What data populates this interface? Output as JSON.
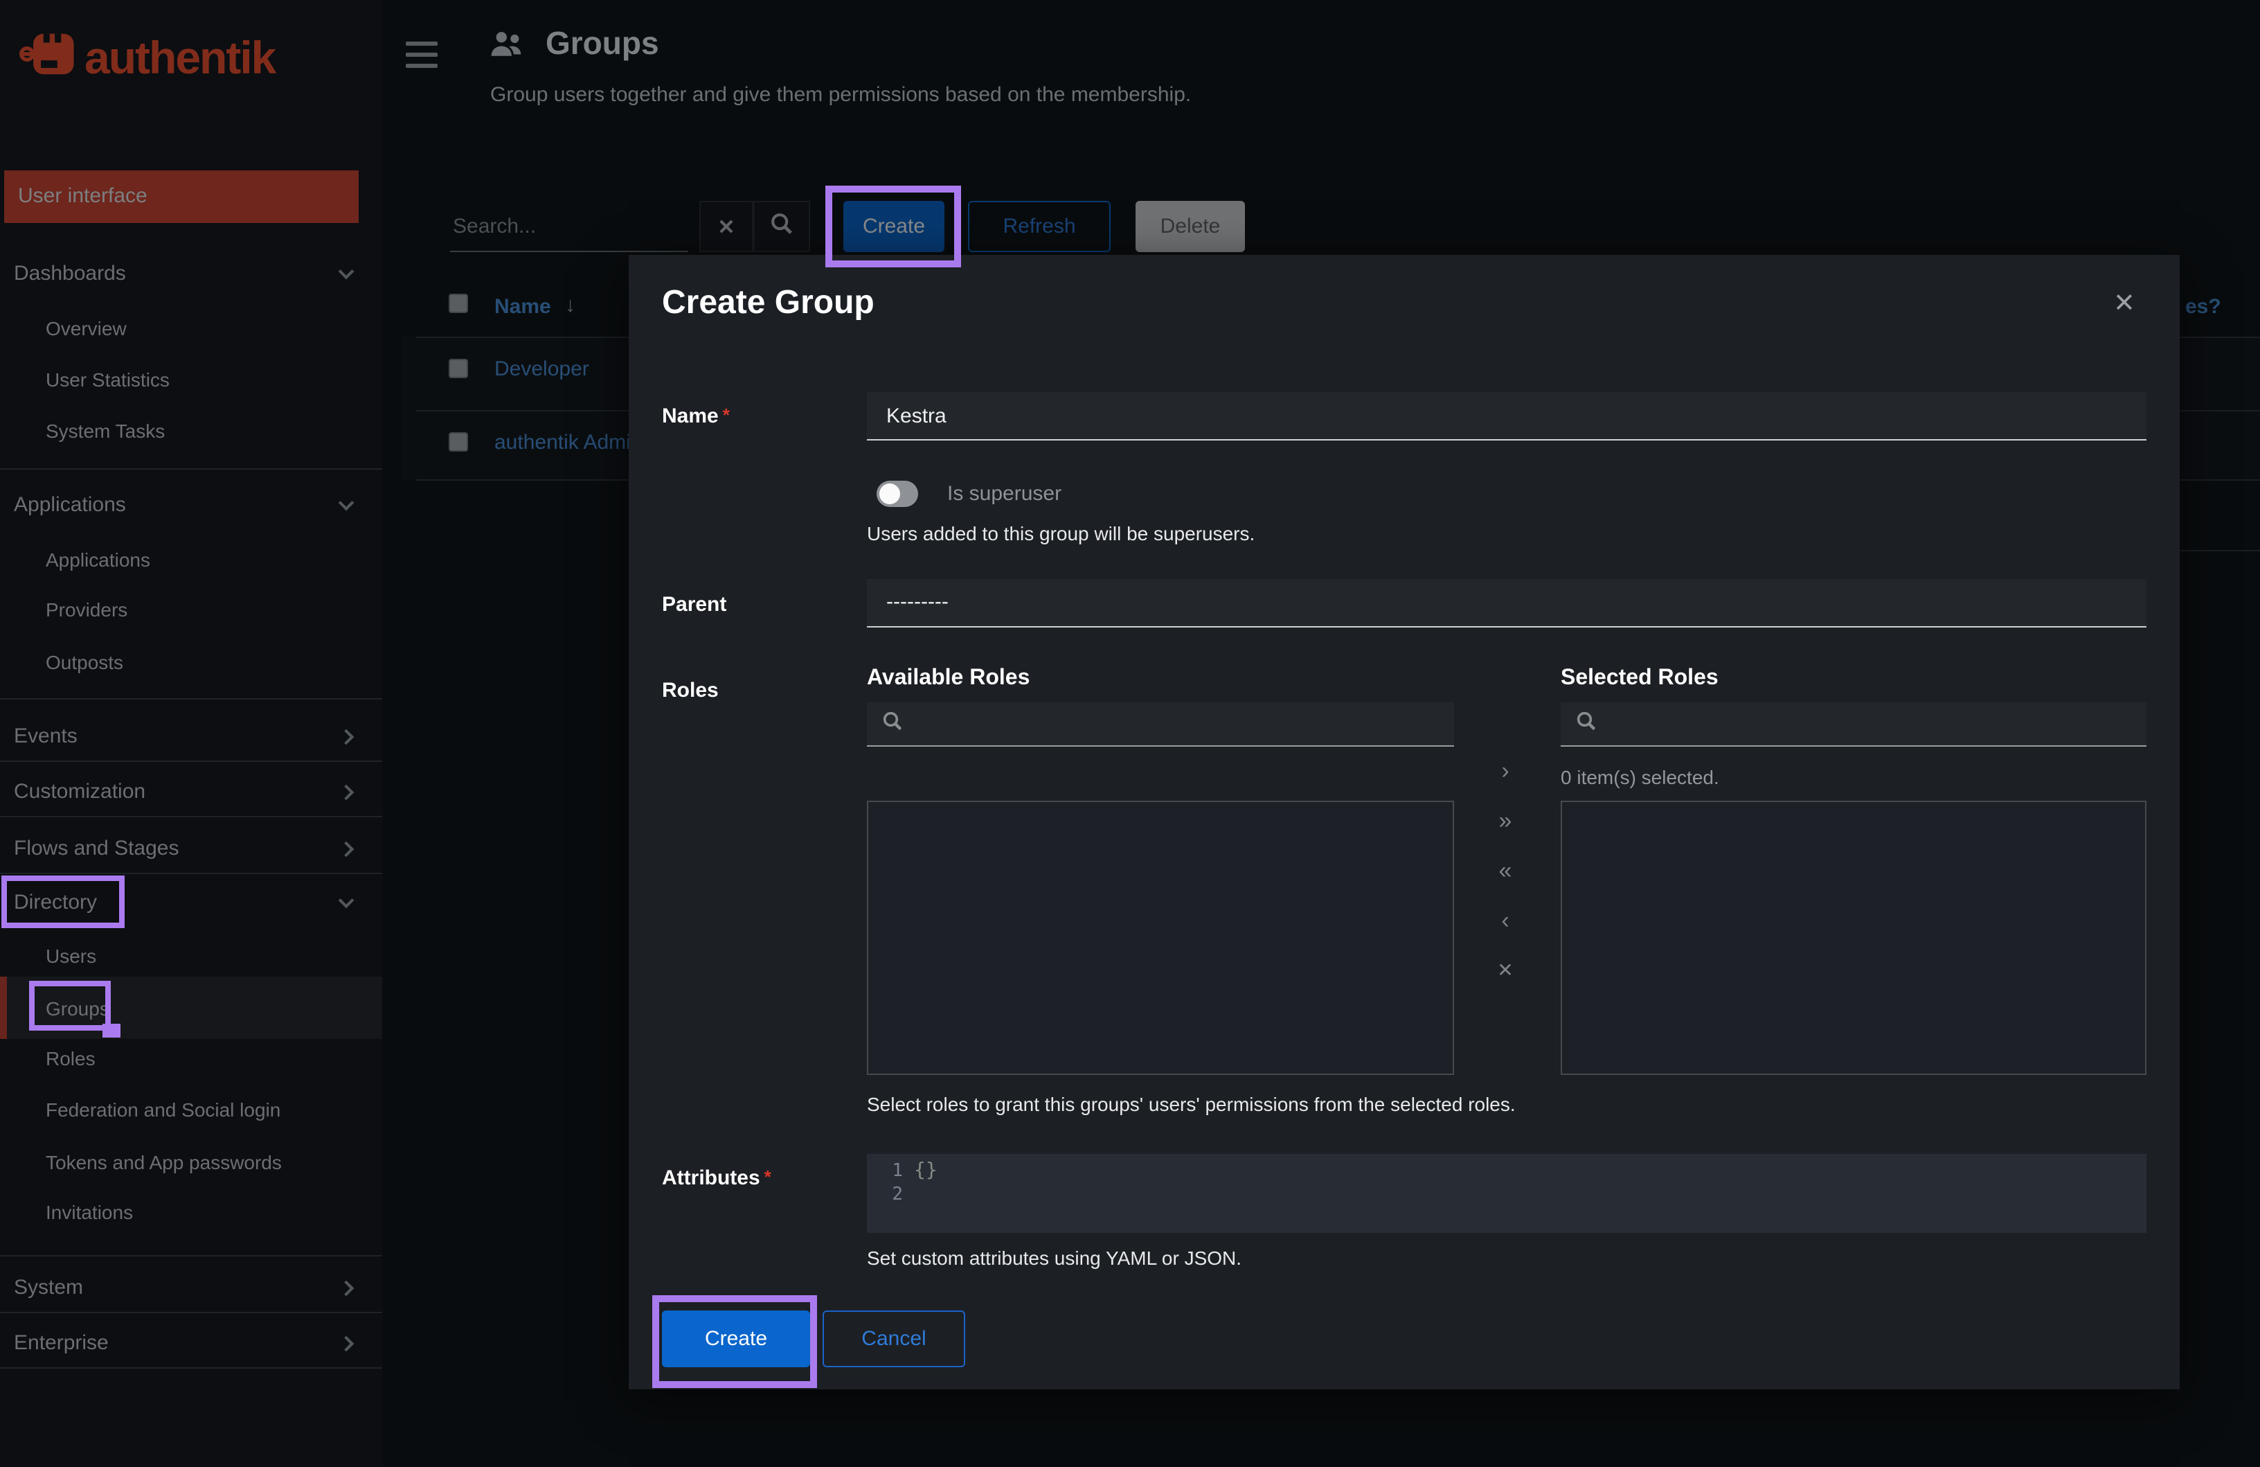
{
  "brand": {
    "logo_text": "authentik"
  },
  "colors": {
    "brand_red": "#f1502f",
    "primary_blue": "#0a66cc",
    "link_blue": "#4a90d9",
    "danger_red": "#dc372b",
    "annotation_purple": "#aa7bef"
  },
  "sidebar": {
    "banner": "User interface",
    "items": [
      {
        "label": "Dashboards"
      },
      {
        "label": "Overview"
      },
      {
        "label": "User Statistics"
      },
      {
        "label": "System Tasks"
      },
      {
        "label": "Applications"
      },
      {
        "label": "Applications"
      },
      {
        "label": "Providers"
      },
      {
        "label": "Outposts"
      },
      {
        "label": "Events"
      },
      {
        "label": "Customization"
      },
      {
        "label": "Flows and Stages"
      },
      {
        "label": "Directory"
      },
      {
        "label": "Users"
      },
      {
        "label": "Groups"
      },
      {
        "label": "Roles"
      },
      {
        "label": "Federation and Social login"
      },
      {
        "label": "Tokens and App passwords"
      },
      {
        "label": "Invitations"
      },
      {
        "label": "System"
      },
      {
        "label": "Enterprise"
      }
    ]
  },
  "header": {
    "title": "Groups",
    "subtitle": "Group users together and give them permissions based on the membership."
  },
  "toolbar": {
    "search_placeholder": "Search...",
    "clear_label": "✕",
    "create_label": "Create",
    "refresh_label": "Refresh",
    "delete_label": "Delete"
  },
  "table": {
    "name_header": "Name",
    "sort_icon": "↓",
    "truncated_header": "es?",
    "rows": [
      "Developer",
      "authentik Admins"
    ]
  },
  "modal": {
    "title": "Create Group",
    "close_label": "✕",
    "required_marker": "*",
    "name": {
      "label": "Name",
      "value": "Kestra"
    },
    "superuser": {
      "label": "Is superuser",
      "state": "off",
      "help": "Users added to this group will be superusers."
    },
    "parent": {
      "label": "Parent",
      "value": "---------"
    },
    "roles": {
      "label": "Roles",
      "available_title": "Available Roles",
      "selected_title": "Selected Roles",
      "selected_count": "0 item(s) selected.",
      "transfer": [
        "›",
        "»",
        "«",
        "‹",
        "✕"
      ],
      "help": "Select roles to grant this groups' users' permissions from the selected roles."
    },
    "attributes": {
      "label": "Attributes",
      "line_numbers": [
        "1",
        "2"
      ],
      "code": "{}",
      "help": "Set custom attributes using YAML or JSON."
    },
    "buttons": {
      "create": "Create",
      "cancel": "Cancel"
    }
  }
}
